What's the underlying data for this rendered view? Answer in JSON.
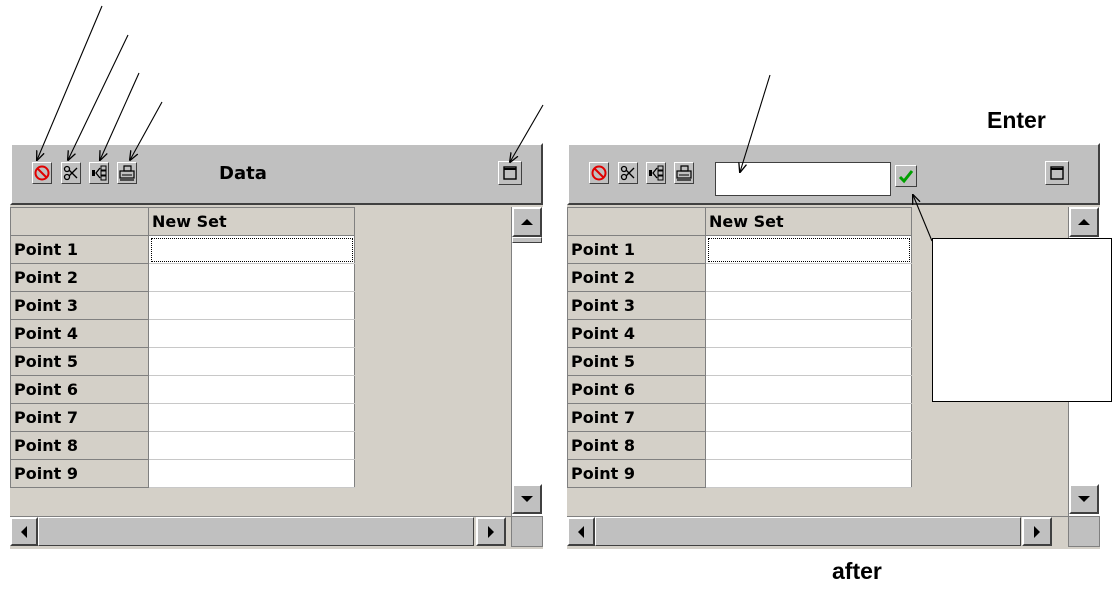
{
  "annotations": {
    "enter_label": "Enter",
    "after_label": "after"
  },
  "left_window": {
    "toolbar": {
      "title": "Data",
      "buttons": [
        {
          "icon": "no-entry-icon"
        },
        {
          "icon": "scissors-icon"
        },
        {
          "icon": "move-icon"
        },
        {
          "icon": "print-icon"
        }
      ],
      "maximize_icon": "maximize-icon"
    },
    "grid": {
      "corner": "",
      "column_header": "New Set",
      "rows": [
        "Point 1",
        "Point 2",
        "Point 3",
        "Point 4",
        "Point 5",
        "Point 6",
        "Point 7",
        "Point 8",
        "Point 9"
      ],
      "selected_row": 0
    }
  },
  "right_window": {
    "toolbar": {
      "buttons": [
        {
          "icon": "no-entry-icon"
        },
        {
          "icon": "scissors-icon"
        },
        {
          "icon": "move-icon"
        },
        {
          "icon": "print-icon"
        }
      ],
      "input_value": "",
      "accept_icon": "checkmark-icon",
      "maximize_icon": "maximize-icon"
    },
    "grid": {
      "corner": "",
      "column_header": "New Set",
      "rows": [
        "Point 1",
        "Point 2",
        "Point 3",
        "Point 4",
        "Point 5",
        "Point 6",
        "Point 7",
        "Point 8",
        "Point 9"
      ],
      "selected_row": 0
    }
  },
  "colors": {
    "toolbar_bg": "#c0c0c0",
    "panel_bg": "#d4d0c8",
    "no_entry_red": "#e00000",
    "check_green": "#00a000"
  }
}
